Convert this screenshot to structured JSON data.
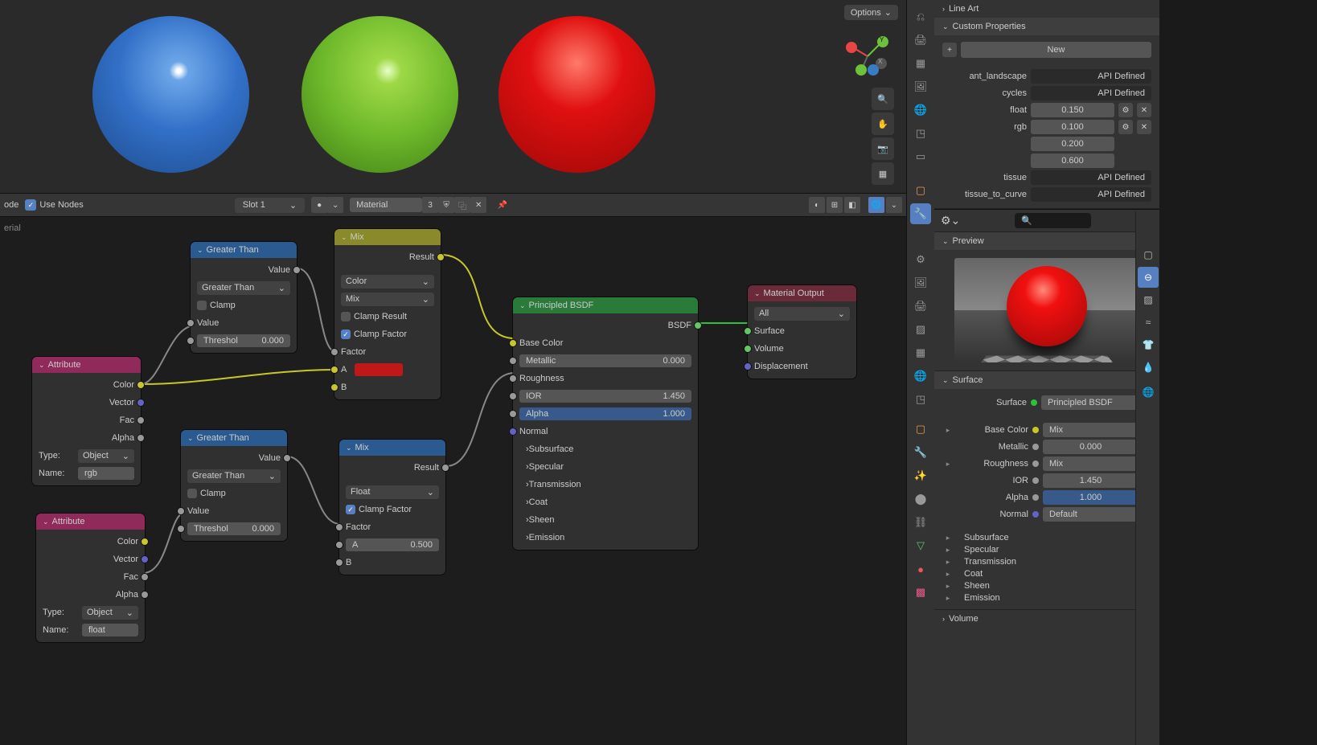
{
  "viewport": {
    "options_label": "Options"
  },
  "node_editor": {
    "header": {
      "mode": "ode",
      "use_nodes": "Use Nodes",
      "slot": "Slot 1",
      "material": "Material",
      "users": "3",
      "left_label": "erial"
    }
  },
  "nodes": {
    "attr1": {
      "title": "Attribute",
      "type_lbl": "Type:",
      "type_val": "Object",
      "name_lbl": "Name:",
      "name_val": "rgb",
      "outputs": [
        "Color",
        "Vector",
        "Fac",
        "Alpha"
      ]
    },
    "attr2": {
      "title": "Attribute",
      "type_lbl": "Type:",
      "type_val": "Object",
      "name_lbl": "Name:",
      "name_val": "float",
      "outputs": [
        "Color",
        "Vector",
        "Fac",
        "Alpha"
      ]
    },
    "gt1": {
      "title": "Greater Than",
      "operation": "Greater Than",
      "clamp": "Clamp",
      "value_out": "Value",
      "value_in": "Value",
      "threshold_lbl": "Threshol",
      "threshold_val": "0.000"
    },
    "gt2": {
      "title": "Greater Than",
      "operation": "Greater Than",
      "clamp": "Clamp",
      "value_out": "Value",
      "value_in": "Value",
      "threshold_lbl": "Threshol",
      "threshold_val": "0.000"
    },
    "mix1": {
      "title": "Mix",
      "result": "Result",
      "data_type": "Color",
      "blend": "Mix",
      "clamp_result": "Clamp Result",
      "clamp_factor": "Clamp Factor",
      "factor": "Factor",
      "a": "A",
      "b": "B",
      "a_color": "#c01818"
    },
    "mix2": {
      "title": "Mix",
      "result": "Result",
      "data_type": "Float",
      "clamp_factor": "Clamp Factor",
      "factor": "Factor",
      "a_lbl": "A",
      "a_val": "0.500",
      "b": "B"
    },
    "bsdf": {
      "title": "Principled BSDF",
      "bsdf": "BSDF",
      "base_color": "Base Color",
      "metallic_lbl": "Metallic",
      "metallic_val": "0.000",
      "roughness": "Roughness",
      "ior_lbl": "IOR",
      "ior_val": "1.450",
      "alpha_lbl": "Alpha",
      "alpha_val": "1.000",
      "normal": "Normal",
      "subsurface": "Subsurface",
      "specular": "Specular",
      "transmission": "Transmission",
      "coat": "Coat",
      "sheen": "Sheen",
      "emission": "Emission"
    },
    "output": {
      "title": "Material Output",
      "target": "All",
      "surface": "Surface",
      "volume": "Volume",
      "displacement": "Displacement"
    }
  },
  "props": {
    "line_art": "Line Art",
    "custom_props": "Custom Properties",
    "new_btn": "New",
    "api_defined": "API Defined",
    "ant_landscape": "ant_landscape",
    "cycles": "cycles",
    "float_lbl": "float",
    "float_val": "0.150",
    "rgb_lbl": "rgb",
    "rgb_vals": [
      "0.100",
      "0.200",
      "0.600"
    ],
    "tissue": "tissue",
    "tissue_to_curve": "tissue_to_curve",
    "preview": "Preview",
    "surface": "Surface",
    "surface_val": "Principled BSDF",
    "base_color_lbl": "Base Color",
    "base_color_val": "Mix",
    "metallic_lbl": "Metallic",
    "metallic_val": "0.000",
    "roughness_lbl": "Roughness",
    "roughness_val": "Mix",
    "ior_lbl": "IOR",
    "ior_val": "1.450",
    "alpha_lbl": "Alpha",
    "alpha_val": "1.000",
    "normal_lbl": "Normal",
    "normal_val": "Default",
    "subsurface": "Subsurface",
    "specular": "Specular",
    "transmission": "Transmission",
    "coat": "Coat",
    "sheen": "Sheen",
    "emission": "Emission",
    "volume": "Volume"
  }
}
